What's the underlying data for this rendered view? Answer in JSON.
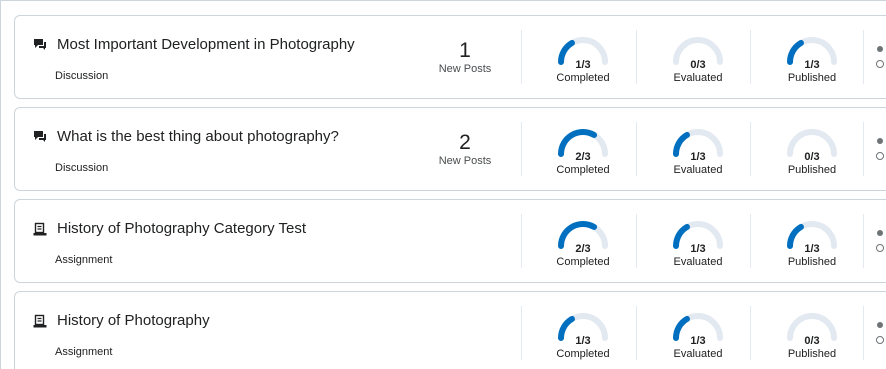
{
  "colors": {
    "accent": "#006fbf",
    "track": "#e3e9f1",
    "border": "#cdd5dc"
  },
  "activities": [
    {
      "title": "Most Important Development in Photography",
      "type": "Discussion",
      "icon": "discussion-icon",
      "new_posts": {
        "count": "1",
        "label": "New Posts"
      },
      "meters": [
        {
          "fraction": "1/3",
          "label": "Completed",
          "value": 0.333
        },
        {
          "fraction": "0/3",
          "label": "Evaluated",
          "value": 0
        },
        {
          "fraction": "1/3",
          "label": "Published",
          "value": 0.333
        }
      ]
    },
    {
      "title": "What is the best thing about photography?",
      "type": "Discussion",
      "icon": "discussion-icon",
      "new_posts": {
        "count": "2",
        "label": "New Posts"
      },
      "meters": [
        {
          "fraction": "2/3",
          "label": "Completed",
          "value": 0.667
        },
        {
          "fraction": "1/3",
          "label": "Evaluated",
          "value": 0.333
        },
        {
          "fraction": "0/3",
          "label": "Published",
          "value": 0
        }
      ]
    },
    {
      "title": "History of Photography Category Test",
      "type": "Assignment",
      "icon": "assignment-icon",
      "meters": [
        {
          "fraction": "2/3",
          "label": "Completed",
          "value": 0.667
        },
        {
          "fraction": "1/3",
          "label": "Evaluated",
          "value": 0.333
        },
        {
          "fraction": "1/3",
          "label": "Published",
          "value": 0.333
        }
      ]
    },
    {
      "title": "History of Photography",
      "type": "Assignment",
      "icon": "assignment-icon",
      "meters": [
        {
          "fraction": "1/3",
          "label": "Completed",
          "value": 0.333
        },
        {
          "fraction": "1/3",
          "label": "Evaluated",
          "value": 0.333
        },
        {
          "fraction": "0/3",
          "label": "Published",
          "value": 0
        }
      ]
    }
  ]
}
